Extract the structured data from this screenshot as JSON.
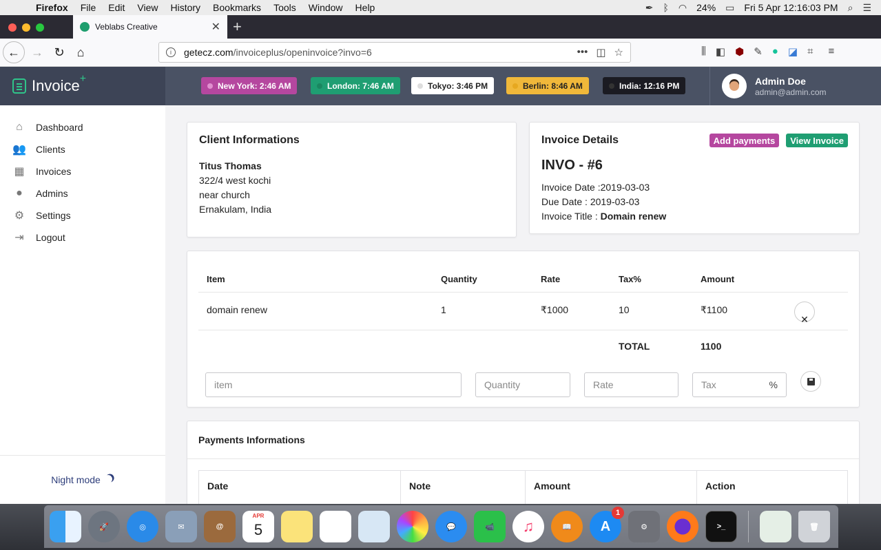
{
  "menubar": {
    "app": "Firefox",
    "items": [
      "File",
      "Edit",
      "View",
      "History",
      "Bookmarks",
      "Tools",
      "Window",
      "Help"
    ],
    "battery": "24%",
    "datetime": "Fri 5 Apr  12:16:03 PM"
  },
  "browser": {
    "tab_title": "Veblabs Creative",
    "url_host": "getecz.com",
    "url_path": "/invoiceplus/openinvoice?invo=6"
  },
  "app": {
    "brand": "Invoice",
    "brand_plus": "+",
    "clocks": [
      {
        "label": "New York: 2:46 AM",
        "color": "#b5479f"
      },
      {
        "label": "London: 7:46 AM",
        "color": "#1f9e72"
      },
      {
        "label": "Tokyo: 3:46 PM",
        "color": "#ffffff"
      },
      {
        "label": "Berlin: 8:46 AM",
        "color": "#f0b83a"
      },
      {
        "label": "India: 12:16 PM",
        "color": "#1b1b22"
      }
    ],
    "user": {
      "name": "Admin Doe",
      "email": "admin@admin.com"
    }
  },
  "sidebar": {
    "items": [
      {
        "label": "Dashboard",
        "icon": "home-icon"
      },
      {
        "label": "Clients",
        "icon": "users-icon"
      },
      {
        "label": "Invoices",
        "icon": "calculator-icon"
      },
      {
        "label": "Admins",
        "icon": "user-icon"
      },
      {
        "label": "Settings",
        "icon": "gear-icon"
      },
      {
        "label": "Logout",
        "icon": "logout-icon"
      }
    ],
    "night_mode": "Night mode"
  },
  "client": {
    "title": "Client Informations",
    "name": "Titus Thomas",
    "address1": "322/4 west kochi",
    "address2": "near church",
    "address3": "Ernakulam, India"
  },
  "details": {
    "title": "Invoice Details",
    "add_payments": "Add payments",
    "view_invoice": "View Invoice",
    "invoice_no": "INVO - #6",
    "invoice_date": "Invoice Date :2019-03-03",
    "due_date": "Due Date : 2019-03-03",
    "invoice_title_label": "Invoice Title : ",
    "invoice_title": "Domain renew"
  },
  "items": {
    "headers": {
      "item": "Item",
      "quantity": "Quantity",
      "rate": "Rate",
      "tax": "Tax%",
      "amount": "Amount"
    },
    "rows": [
      {
        "item": "domain renew",
        "quantity": "1",
        "rate": "₹1000",
        "tax": "10",
        "amount": "₹1100"
      }
    ],
    "total_label": "TOTAL",
    "total_value": "1100",
    "inputs": {
      "item": "item",
      "quantity": "Quantity",
      "rate": "Rate",
      "tax": "Tax",
      "tax_suffix": "%"
    }
  },
  "payments": {
    "title": "Payments Informations",
    "headers": [
      "Date",
      "Note",
      "Amount",
      "Action"
    ]
  },
  "dock": {
    "calendar_month": "APR",
    "calendar_day": "5",
    "appstore_badge": "1"
  }
}
